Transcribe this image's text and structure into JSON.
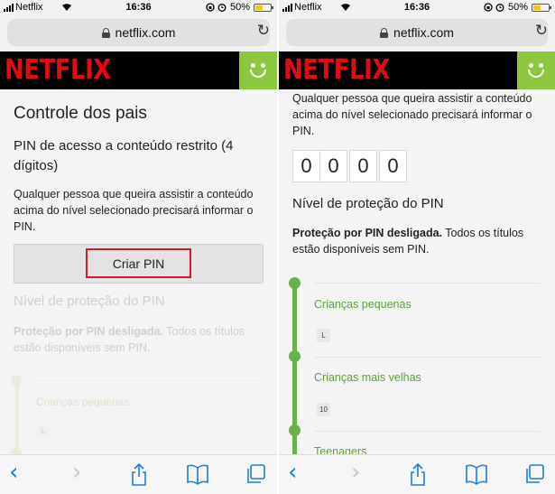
{
  "status": {
    "carrier": "Netflix",
    "time": "16:36",
    "battery": "50%",
    "battery_level": 0.5
  },
  "browser": {
    "url": "netflix.com"
  },
  "brand": {
    "logo": "NETFLIX",
    "logo_color": "#e50914",
    "avatar_color": "#8dc63f"
  },
  "left": {
    "title": "Controle dos pais",
    "pin_heading": "PIN de acesso a conteúdo restrito (4 dígitos)",
    "description": "Qualquer pessoa que queira assistir a conteúdo acima do nível selecionado precisará informar o PIN.",
    "create_pin": "Criar PIN",
    "level_title": "Nível de proteção do PIN",
    "protection_bold": "Proteção por PIN desligada.",
    "protection_rest": " Todos os títulos estão disponíveis sem PIN.",
    "level_first": "Crianças pequenas",
    "level_first_rating": "L"
  },
  "right": {
    "description": "Qualquer pessoa que queira assistir a conteúdo acima do nível selecionado precisará informar o PIN.",
    "pin_digits": [
      "0",
      "0",
      "0",
      "0"
    ],
    "level_title": "Nível de proteção do PIN",
    "protection_bold": "Proteção por PIN desligada.",
    "protection_rest": " Todos os títulos estão disponíveis sem PIN.",
    "levels": [
      {
        "label": "Crianças pequenas",
        "rating": "L"
      },
      {
        "label": "Crianças mais velhas",
        "rating": "10"
      },
      {
        "label": "Teenagers",
        "rating": ""
      }
    ]
  },
  "icons": [
    "signal-icon",
    "wifi-icon",
    "lock-icon",
    "reload-icon",
    "back-icon",
    "forward-icon",
    "share-icon",
    "bookmarks-icon",
    "tabs-icon"
  ]
}
